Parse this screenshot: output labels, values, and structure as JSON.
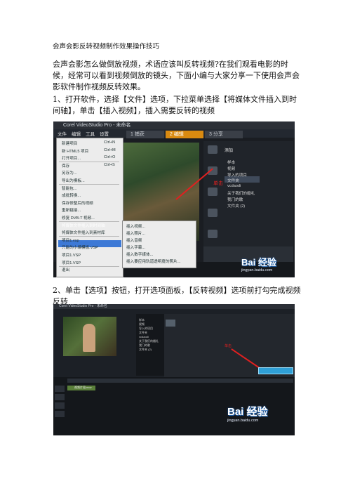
{
  "doc": {
    "title": "会声会影反转视频制作效果操作技巧",
    "intro": "会声会影怎么做倒放视频，术语应该叫反转视频?在我们观看电影的时候，经常可以看到视频倒放的镜头，下面小编与大家分享一下使用会声会影软件制作视频反转效果。",
    "step1": "1、打开软件，选择【文件】选项，下拉菜单选择【将媒体文件插入到时间轴】，单击【插入视频】，插入需要反转的视频",
    "step2": "2、单击【选项】按钮，打开选项面板，【反转视频】选项前打勾完成视频反转"
  },
  "shot1": {
    "window_title": "Corel VideoStudio Pro - 未命名",
    "menus": [
      "文件",
      "编辑",
      "工具",
      "设置"
    ],
    "tabs": [
      "1 捕获",
      "2 编辑",
      "3 分享"
    ],
    "file_menu": [
      {
        "label": "新建项目",
        "shortcut": "Ctrl+N"
      },
      {
        "label": "新 HTML5 项目",
        "shortcut": "Ctrl+M"
      },
      {
        "label": "打开项目...",
        "shortcut": "Ctrl+O"
      },
      {
        "label": "保存",
        "shortcut": "Ctrl+S"
      },
      {
        "label": "另存为...",
        "shortcut": ""
      },
      {
        "label": "导出为模板...",
        "shortcut": ""
      },
      {
        "label": "智能包...",
        "shortcut": ""
      },
      {
        "label": "成批转换...",
        "shortcut": ""
      },
      {
        "label": "保存修整后的视频",
        "shortcut": ""
      },
      {
        "label": "重新链接...",
        "shortcut": ""
      },
      {
        "label": "修复 DVB-T 视频...",
        "shortcut": ""
      },
      {
        "label": "将媒体文件插入到时间轴",
        "shortcut": ""
      },
      {
        "label": "将媒体文件插入到素材库",
        "shortcut": ""
      },
      {
        "label": "项目1.vsp",
        "shortcut": ""
      },
      {
        "label": "只能的小编模板.VSP",
        "shortcut": ""
      },
      {
        "label": "项目1.VSP",
        "shortcut": ""
      },
      {
        "label": "项目1.VSP",
        "shortcut": ""
      },
      {
        "label": "退出",
        "shortcut": ""
      }
    ],
    "submenu": [
      "插入视频...",
      "插入照片...",
      "插入音频",
      "插入字幕...",
      "插入数字媒体...",
      "插入要应用轨道透明度的照片..."
    ],
    "library_add": "添加",
    "library_items": [
      "样本",
      "视频",
      "导入的项目",
      "文件夹",
      "vcdaodi",
      "关于我们的婚礼",
      "我门的歌",
      "文件夹 (2)"
    ],
    "annotation": "单击",
    "watermark": "Bai 经验",
    "watermark_url": "jingyan.baidu.com"
  },
  "shot2": {
    "window_title": "Corel VideoStudio Pro - 未命名",
    "panel_items": [
      "样本",
      "视频",
      "导入的项目",
      "文件夹",
      "vcdaodi",
      "关于我们的婚礼",
      "我门的歌",
      "文件夹 (2)"
    ],
    "annotation": "单击",
    "track_label": "视频片段.mov",
    "watermark": "Bai 经验",
    "watermark_url": "jingyan.baidu.com"
  }
}
